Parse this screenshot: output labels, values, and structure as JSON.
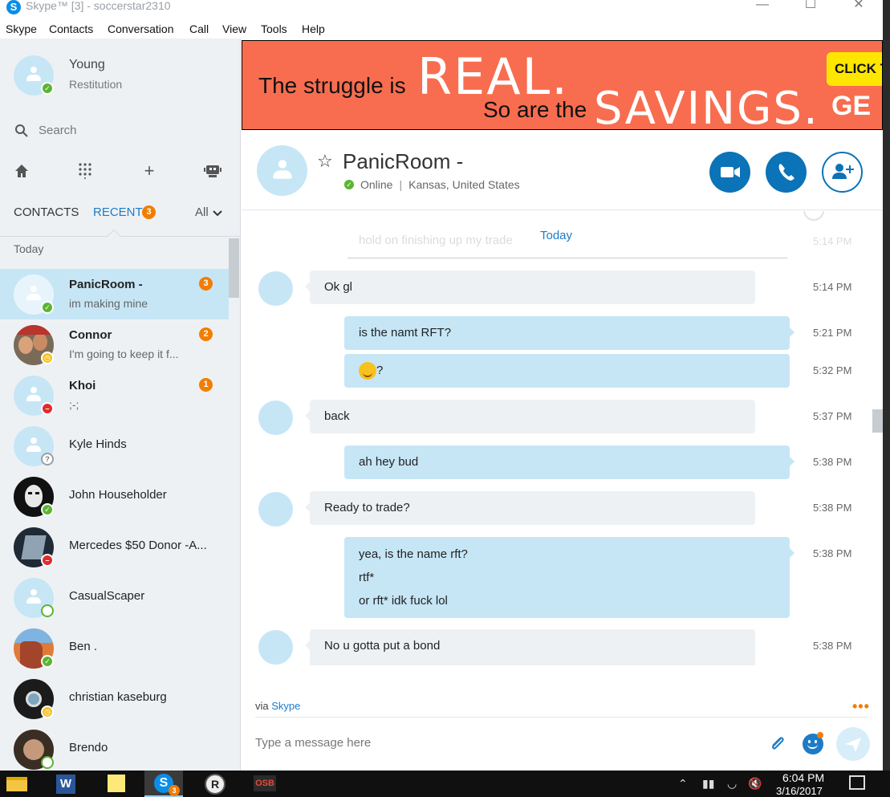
{
  "window": {
    "title": "Skype™ [3] - soccerstar2310",
    "logo": "S"
  },
  "menu": [
    "Skype",
    "Contacts",
    "Conversation",
    "Call",
    "View",
    "Tools",
    "Help"
  ],
  "profile": {
    "name": "Young",
    "mood": "Restitution",
    "status": "online"
  },
  "search": {
    "label": "Search"
  },
  "tabs": {
    "contacts": "CONTACTS",
    "recent": "RECENT",
    "recent_badge": "3",
    "filter": "All"
  },
  "recent_section_label": "Today",
  "contacts": [
    {
      "name": "PanicRoom -",
      "sub": "im making mine",
      "badge": "3",
      "status": "online",
      "bold": true,
      "selected": true
    },
    {
      "name": "Connor",
      "sub": "I'm going to keep it f...",
      "badge": "2",
      "status": "away",
      "bold": true
    },
    {
      "name": "Khoi",
      "sub": ";-;",
      "badge": "1",
      "status": "dnd",
      "bold": true
    },
    {
      "name": "Kyle Hinds",
      "sub": "",
      "status": "unknown"
    },
    {
      "name": "John Householder",
      "sub": "",
      "status": "online"
    },
    {
      "name": "Mercedes $50 Donor -A...",
      "sub": "",
      "status": "dnd"
    },
    {
      "name": "CasualScaper",
      "sub": "",
      "status": "offline"
    },
    {
      "name": "Ben .",
      "sub": "",
      "status": "online"
    },
    {
      "name": "christian kaseburg",
      "sub": "",
      "status": "away"
    },
    {
      "name": "Brendo",
      "sub": "",
      "status": "offline"
    }
  ],
  "banner": {
    "line1": "The struggle is",
    "big1": "REAL.",
    "line2": "So are the",
    "big2": "SAVINGS.",
    "trail": "GE",
    "cta": "CLICK T"
  },
  "conversation": {
    "name": "PanicRoom -",
    "status": "Online",
    "location": "Kansas, United States",
    "separator": "Today",
    "ghost_text": "hold on finishing up my trade",
    "ghost_time": "5:14 PM",
    "messages": [
      {
        "dir": "in",
        "lines": [
          "Ok gl"
        ],
        "time": "5:14 PM"
      },
      {
        "dir": "out",
        "lines": [
          "is the namt RFT?"
        ],
        "time": "5:21 PM"
      },
      {
        "dir": "out",
        "lines": [
          "?"
        ],
        "time": "5:32 PM",
        "emoji": true
      },
      {
        "dir": "in",
        "lines": [
          "back"
        ],
        "time": "5:37 PM"
      },
      {
        "dir": "out",
        "lines": [
          "ah hey bud"
        ],
        "time": "5:38 PM"
      },
      {
        "dir": "in",
        "lines": [
          "Ready to trade?"
        ],
        "time": "5:38 PM"
      },
      {
        "dir": "out",
        "lines": [
          "yea, is the name rft?",
          "rtf*",
          "or rft* idk fuck lol"
        ],
        "time": "5:38 PM"
      },
      {
        "dir": "in",
        "lines": [
          "No u gotta put a bond"
        ],
        "time": "5:38 PM"
      }
    ]
  },
  "footer": {
    "via": "via",
    "via_link": "Skype",
    "compose_placeholder": "Type a message here"
  },
  "taskbar": {
    "time": "6:04 PM",
    "date": "3/16/2017",
    "skype_badge": "3",
    "osb_label": "OSB"
  },
  "colors": {
    "accent": "#0b73b7",
    "bubble_out": "#c6e6f6",
    "bubble_in": "#eef1f4",
    "badge": "#f27d00",
    "online": "#5cb531"
  }
}
